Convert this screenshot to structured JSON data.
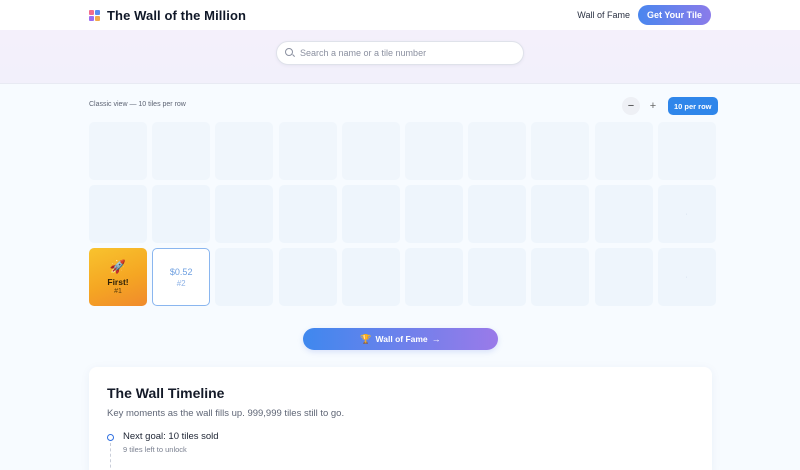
{
  "header": {
    "title": "The Wall of the Million",
    "nav_link": "Wall of Fame",
    "cta": "Get Your Tile"
  },
  "search": {
    "placeholder": "Search a name or a tile number"
  },
  "view": {
    "label": "Classic view — 10 tiles per row",
    "minus": "−",
    "plus": "+",
    "per_row": "10 per row"
  },
  "tiles": {
    "first": {
      "emoji": "🚀",
      "name": "First!",
      "number": "#1"
    },
    "second": {
      "amount": "$0.52",
      "number": "#2"
    },
    "dot": "·"
  },
  "wall_of_fame_button": {
    "icon": "🏆",
    "label": "Wall of Fame",
    "arrow": "→"
  },
  "timeline": {
    "title": "The Wall Timeline",
    "subtitle": "Key moments as the wall fills up. 999,999 tiles still to go.",
    "items": [
      {
        "goal": "Next goal: 10 tiles sold",
        "note": "9 tiles left to unlock"
      }
    ]
  },
  "colors": {
    "accent": "#2f86ea",
    "gradient_start": "#4a86ee",
    "gradient_end": "#8a7bea",
    "first_tile": "#f5a623"
  }
}
